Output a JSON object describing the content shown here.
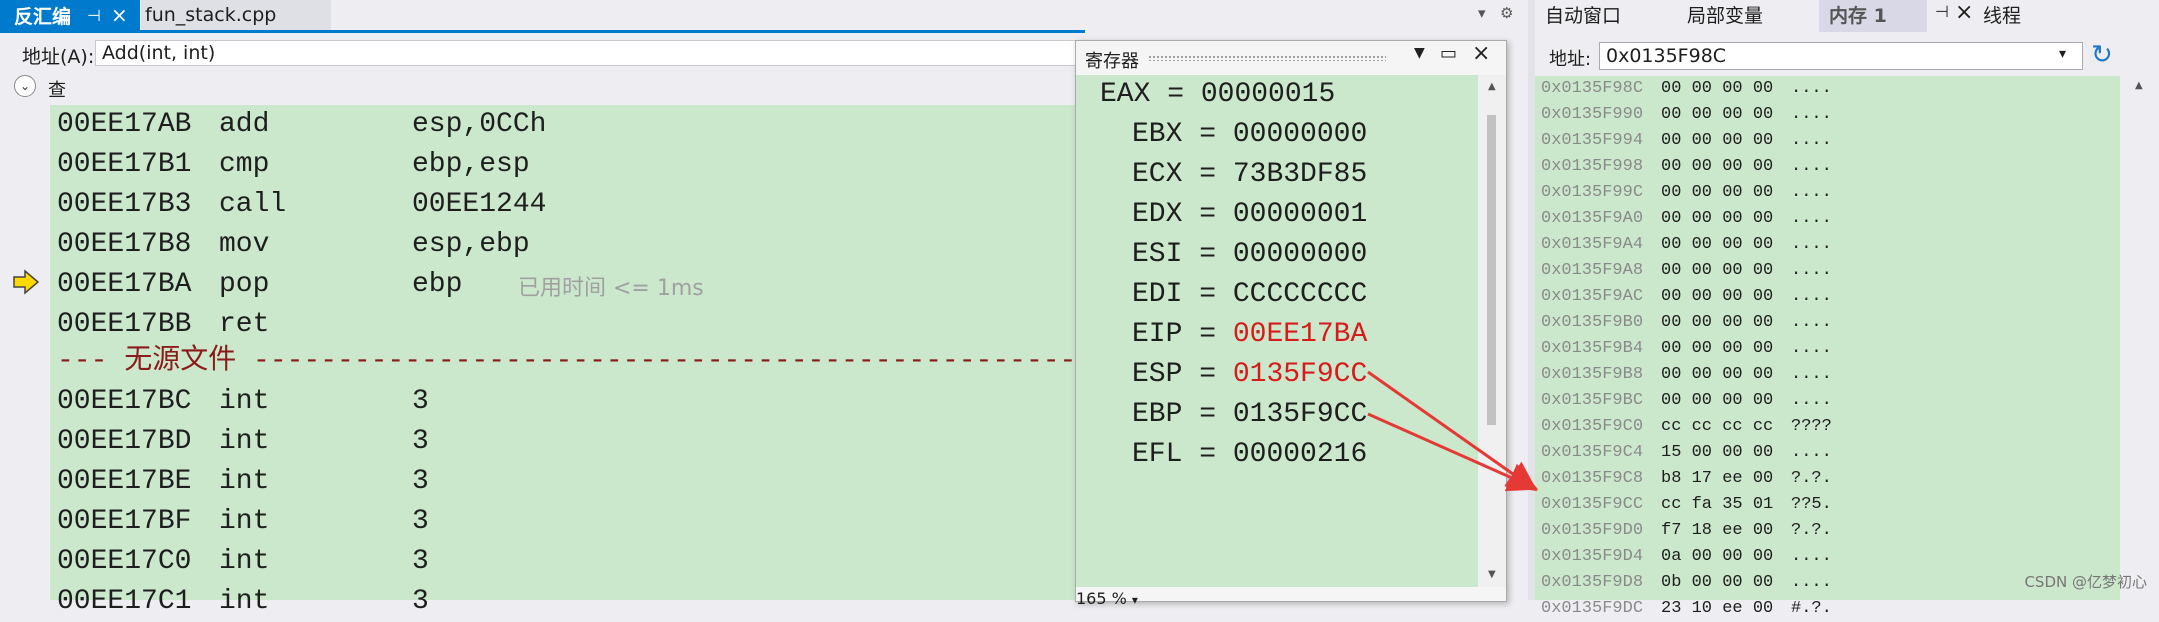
{
  "disasm": {
    "tab_active": "反汇编",
    "tab_inactive": "fun_stack.cpp",
    "address_label": "地址(A):",
    "address_value": "Add(int, int)",
    "view_options": "查看选项",
    "elapsed": "已用时间 <= 1ms",
    "separator": "--- 无源文件 -----------------------------------------------------------------------",
    "lines_a": [
      {
        "addr": "00EE17AB",
        "op": "add",
        "args": "esp,0CCh"
      },
      {
        "addr": "00EE17B1",
        "op": "cmp",
        "args": "ebp,esp"
      },
      {
        "addr": "00EE17B3",
        "op": "call",
        "args": "00EE1244"
      },
      {
        "addr": "00EE17B8",
        "op": "mov",
        "args": "esp,ebp"
      },
      {
        "addr": "00EE17BA",
        "op": "pop",
        "args": "ebp"
      },
      {
        "addr": "00EE17BB",
        "op": "ret",
        "args": ""
      }
    ],
    "lines_b": [
      {
        "addr": "00EE17BC",
        "op": "int",
        "args": "3"
      },
      {
        "addr": "00EE17BD",
        "op": "int",
        "args": "3"
      },
      {
        "addr": "00EE17BE",
        "op": "int",
        "args": "3"
      },
      {
        "addr": "00EE17BF",
        "op": "int",
        "args": "3"
      },
      {
        "addr": "00EE17C0",
        "op": "int",
        "args": "3"
      },
      {
        "addr": "00EE17C1",
        "op": "int",
        "args": "3"
      }
    ]
  },
  "registers": {
    "title": "寄存器",
    "zoom": "165 %",
    "items": [
      {
        "name": "EAX",
        "value": "00000015",
        "changed": false
      },
      {
        "name": "EBX",
        "value": "00000000",
        "changed": false
      },
      {
        "name": "ECX",
        "value": "73B3DF85",
        "changed": false
      },
      {
        "name": "EDX",
        "value": "00000001",
        "changed": false
      },
      {
        "name": "ESI",
        "value": "00000000",
        "changed": false
      },
      {
        "name": "EDI",
        "value": "CCCCCCCC",
        "changed": false
      },
      {
        "name": "EIP",
        "value": "00EE17BA",
        "changed": true
      },
      {
        "name": "ESP",
        "value": "0135F9CC",
        "changed": true
      },
      {
        "name": "EBP",
        "value": "0135F9CC",
        "changed": false
      },
      {
        "name": "EFL",
        "value": "00000216",
        "changed": false
      }
    ]
  },
  "right_tabs": [
    {
      "label": "自动窗口",
      "active": false
    },
    {
      "label": "局部变量",
      "active": false
    },
    {
      "label": "内存 1",
      "active": true
    },
    {
      "label": "线程",
      "active": false
    }
  ],
  "memory": {
    "address_label": "地址:",
    "address_value": "0x0135F98C",
    "rows": [
      {
        "addr": "0x0135F98C",
        "hex": "00 00 00 00",
        "ascii": "...."
      },
      {
        "addr": "0x0135F990",
        "hex": "00 00 00 00",
        "ascii": "...."
      },
      {
        "addr": "0x0135F994",
        "hex": "00 00 00 00",
        "ascii": "...."
      },
      {
        "addr": "0x0135F998",
        "hex": "00 00 00 00",
        "ascii": "...."
      },
      {
        "addr": "0x0135F99C",
        "hex": "00 00 00 00",
        "ascii": "...."
      },
      {
        "addr": "0x0135F9A0",
        "hex": "00 00 00 00",
        "ascii": "...."
      },
      {
        "addr": "0x0135F9A4",
        "hex": "00 00 00 00",
        "ascii": "...."
      },
      {
        "addr": "0x0135F9A8",
        "hex": "00 00 00 00",
        "ascii": "...."
      },
      {
        "addr": "0x0135F9AC",
        "hex": "00 00 00 00",
        "ascii": "...."
      },
      {
        "addr": "0x0135F9B0",
        "hex": "00 00 00 00",
        "ascii": "...."
      },
      {
        "addr": "0x0135F9B4",
        "hex": "00 00 00 00",
        "ascii": "...."
      },
      {
        "addr": "0x0135F9B8",
        "hex": "00 00 00 00",
        "ascii": "...."
      },
      {
        "addr": "0x0135F9BC",
        "hex": "00 00 00 00",
        "ascii": "...."
      },
      {
        "addr": "0x0135F9C0",
        "hex": "cc cc cc cc",
        "ascii": "????"
      },
      {
        "addr": "0x0135F9C4",
        "hex": "15 00 00 00",
        "ascii": "...."
      },
      {
        "addr": "0x0135F9C8",
        "hex": "b8 17 ee 00",
        "ascii": "?.?."
      },
      {
        "addr": "0x0135F9CC",
        "hex": "cc fa 35 01",
        "ascii": "??5."
      },
      {
        "addr": "0x0135F9D0",
        "hex": "f7 18 ee 00",
        "ascii": "?.?."
      },
      {
        "addr": "0x0135F9D4",
        "hex": "0a 00 00 00",
        "ascii": "...."
      },
      {
        "addr": "0x0135F9D8",
        "hex": "0b 00 00 00",
        "ascii": "...."
      },
      {
        "addr": "0x0135F9DC",
        "hex": "23 10 ee 00",
        "ascii": "#.?."
      }
    ]
  },
  "watermark": "CSDN @亿梦初心",
  "colors": {
    "accent": "#007acc",
    "code_bg": "#cbe8cc",
    "changed_register": "#d71a1a",
    "annotation_arrow": "#e53935"
  }
}
